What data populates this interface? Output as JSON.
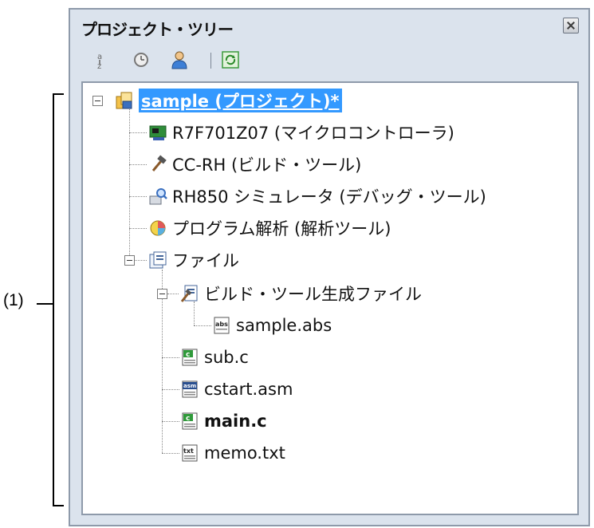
{
  "annotation": {
    "label": "(1)"
  },
  "panel": {
    "title": "プロジェクト・ツリー",
    "toolbar": {
      "buttons": [
        {
          "icon": "sort-icon"
        },
        {
          "icon": "clock-icon"
        },
        {
          "icon": "person-icon"
        },
        {
          "icon": "refresh-icon"
        }
      ]
    }
  },
  "tree": {
    "nodes": [
      {
        "label": "sample (プロジェクト)*",
        "icon": "project-icon",
        "level": 0,
        "expanded": true,
        "selected": true
      },
      {
        "label": "R7F701Z07 (マイクロコントローラ)",
        "icon": "microcontroller-icon",
        "level": 1
      },
      {
        "label": "CC-RH (ビルド・ツール)",
        "icon": "hammer-icon",
        "level": 1
      },
      {
        "label": "RH850 シミュレータ (デバッグ・ツール)",
        "icon": "debug-tool-icon",
        "level": 1
      },
      {
        "label": "プログラム解析 (解析ツール)",
        "icon": "analysis-icon",
        "level": 1
      },
      {
        "label": "ファイル",
        "icon": "folder-icon",
        "level": 1,
        "expanded": true
      },
      {
        "label": "ビルド・ツール生成ファイル",
        "icon": "build-files-icon",
        "level": 2,
        "expanded": true
      },
      {
        "label": "sample.abs",
        "icon": "abs-file-icon",
        "level": 3
      },
      {
        "label": "sub.c",
        "icon": "c-file-icon",
        "level": 2
      },
      {
        "label": "cstart.asm",
        "icon": "asm-file-icon",
        "level": 2
      },
      {
        "label": "main.c",
        "icon": "c-file-icon",
        "level": 2,
        "bold": true
      },
      {
        "label": "memo.txt",
        "icon": "txt-file-icon",
        "level": 2
      }
    ]
  },
  "colors": {
    "selection": "#3399ff",
    "panel_bg": "#dbe3ed",
    "border": "#8e9aaa"
  }
}
